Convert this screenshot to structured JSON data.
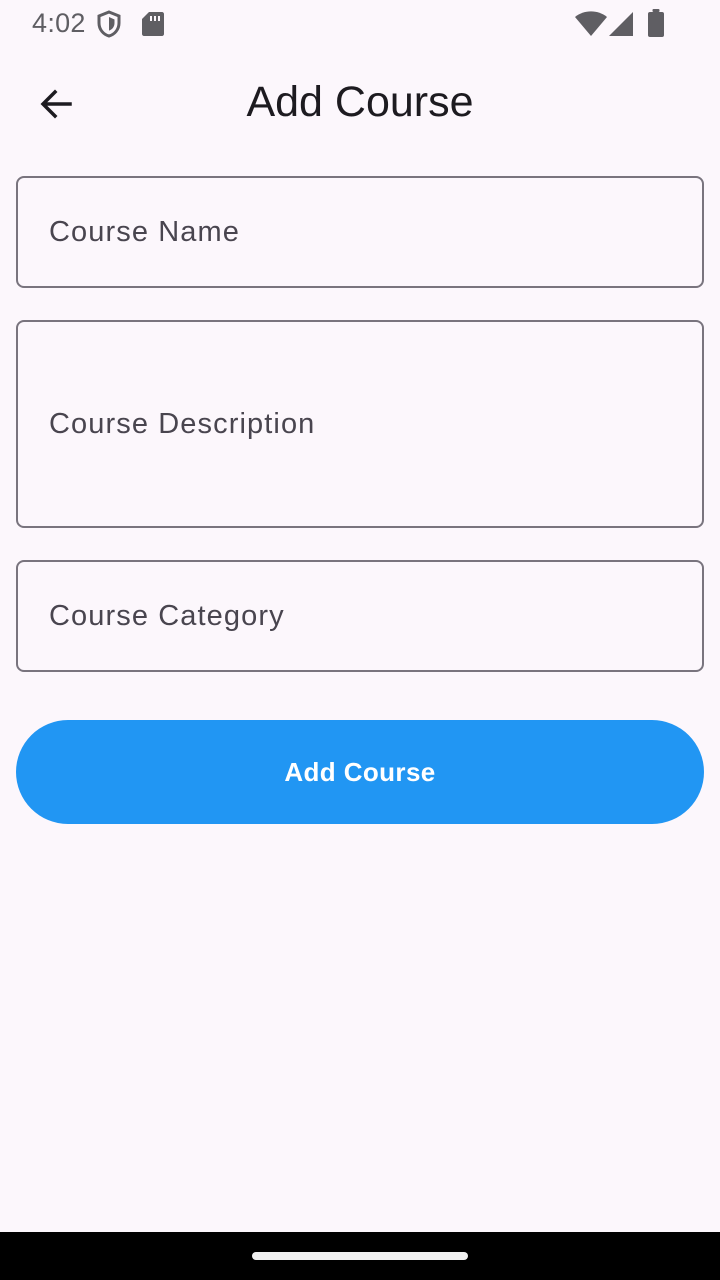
{
  "status_bar": {
    "time": "4:02",
    "icons": [
      "shield-icon",
      "sd-card-icon",
      "wifi-icon",
      "cell-signal-icon",
      "battery-icon"
    ]
  },
  "app_bar": {
    "back_icon": "arrow-back-icon",
    "title": "Add Course"
  },
  "form": {
    "course_name": {
      "label": "Course Name",
      "value": ""
    },
    "course_description": {
      "label": "Course Description",
      "value": ""
    },
    "course_category": {
      "label": "Course Category",
      "value": ""
    }
  },
  "submit_button": {
    "label": "Add Course"
  },
  "colors": {
    "background": "#fcf7fc",
    "accent": "#2196f3",
    "field_border": "#79747e",
    "label_text": "#49454f"
  }
}
